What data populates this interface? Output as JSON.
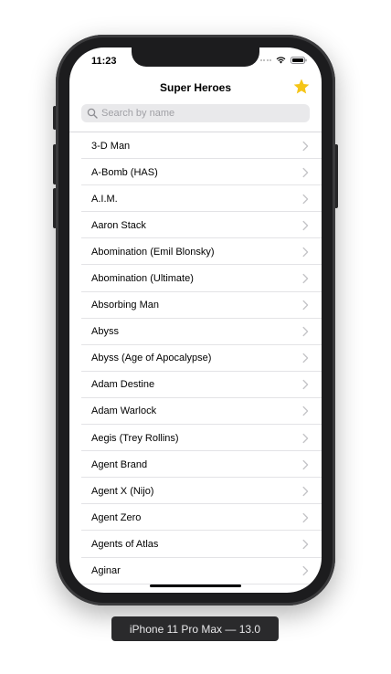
{
  "status_bar": {
    "time": "11:23"
  },
  "nav": {
    "title": "Super Heroes"
  },
  "search": {
    "placeholder": "Search by name",
    "value": ""
  },
  "heroes": [
    "3-D Man",
    "A-Bomb (HAS)",
    "A.I.M.",
    "Aaron Stack",
    "Abomination (Emil Blonsky)",
    "Abomination (Ultimate)",
    "Absorbing Man",
    "Abyss",
    "Abyss (Age of Apocalypse)",
    "Adam Destine",
    "Adam Warlock",
    "Aegis (Trey Rollins)",
    "Agent Brand",
    "Agent X (Nijo)",
    "Agent Zero",
    "Agents of Atlas",
    "Aginar"
  ],
  "device_label": "iPhone 11 Pro Max — 13.0",
  "colors": {
    "star": "#f5c518",
    "chevron": "#c4c4c7"
  },
  "icons": {
    "favorite": "star-icon",
    "search": "magnifying-glass-icon",
    "row_disclosure": "chevron-right-icon"
  }
}
